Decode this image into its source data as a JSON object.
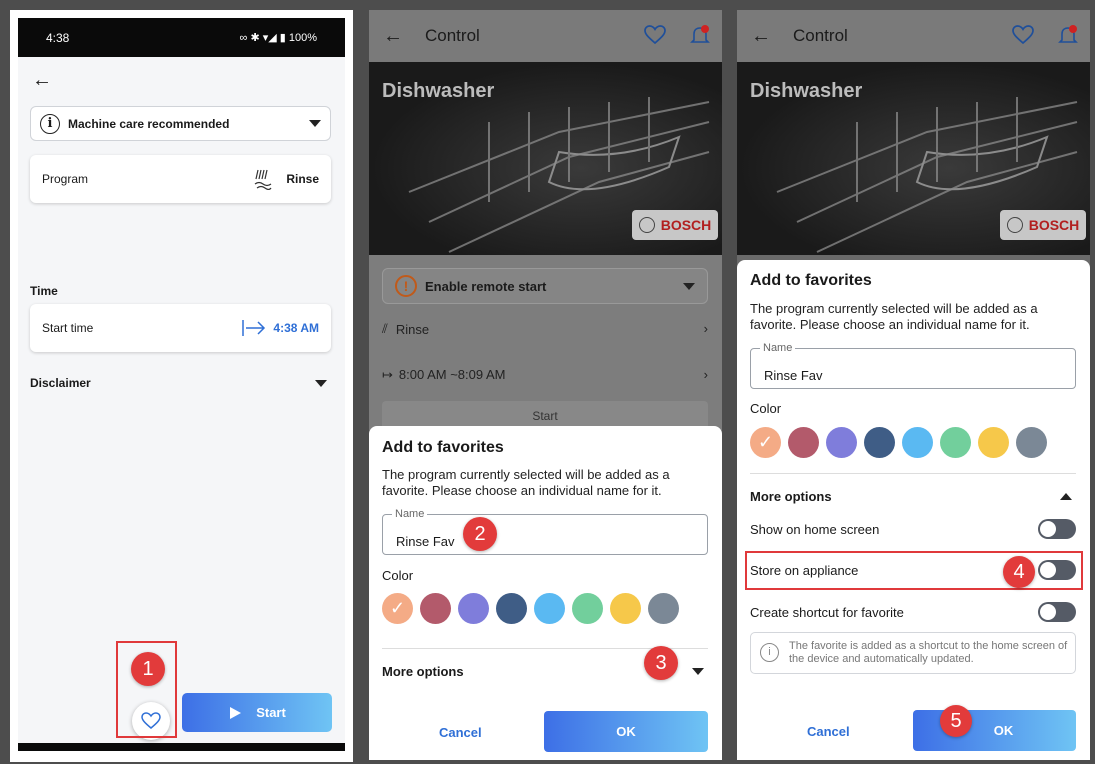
{
  "panel1": {
    "status_time": "4:38",
    "status_right": "∞ ✱ ▾◢ ▮ 100%",
    "machine_care": "Machine care recommended",
    "program_label": "Program",
    "program_value": "Rinse",
    "time_heading": "Time",
    "start_time_label": "Start time",
    "start_time_value": "4:38 AM",
    "disclaimer": "Disclaimer",
    "start_button": "Start",
    "annotation": "1"
  },
  "panel2": {
    "header_title": "Control",
    "appliance_name": "Dishwasher",
    "brand": "BOSCH",
    "remote_start": "Enable remote start",
    "program": "Rinse",
    "time_range": "8:00 AM  ~8:09 AM",
    "start_behind": "Start",
    "sheet_title": "Add to favorites",
    "sheet_text": "The program currently selected will be added as a favorite. Please choose an individual name for it.",
    "name_label": "Name",
    "name_value": "Rinse Fav",
    "color_label": "Color",
    "more_options": "More options",
    "cancel": "Cancel",
    "ok": "OK",
    "annotation_name": "2",
    "annotation_more": "3"
  },
  "panel3": {
    "header_title": "Control",
    "appliance_name": "Dishwasher",
    "brand": "BOSCH",
    "sheet_title": "Add to favorites",
    "sheet_text": "The program currently selected will be added as a favorite. Please choose an individual name for it.",
    "name_label": "Name",
    "name_value": "Rinse Fav",
    "color_label": "Color",
    "more_options": "More options",
    "show_home": "Show on home screen",
    "store_appliance": "Store on appliance",
    "create_shortcut": "Create shortcut for favorite",
    "info_text": "The favorite is added as a shortcut to the home screen of the device and automatically updated.",
    "cancel": "Cancel",
    "ok": "OK",
    "annotation_store": "4",
    "annotation_ok": "5"
  },
  "colors": {
    "swatches": [
      "#f4ab86",
      "#b35a6b",
      "#7f7ddb",
      "#3f5d86",
      "#5ab9f2",
      "#72cf9c",
      "#f6c84a",
      "#7b8896"
    ],
    "accent": "#2f6fd6",
    "annotation": "#e23b3b"
  },
  "icons": {
    "back": "arrow-left-icon",
    "info": "info-circle-icon",
    "rinse": "rinse-program-icon",
    "start_time": "arrow-right-to-bar-icon",
    "heart": "heart-icon",
    "bell": "bell-icon",
    "play": "play-icon",
    "check": "check-icon",
    "chevron": "chevron-right-icon"
  }
}
